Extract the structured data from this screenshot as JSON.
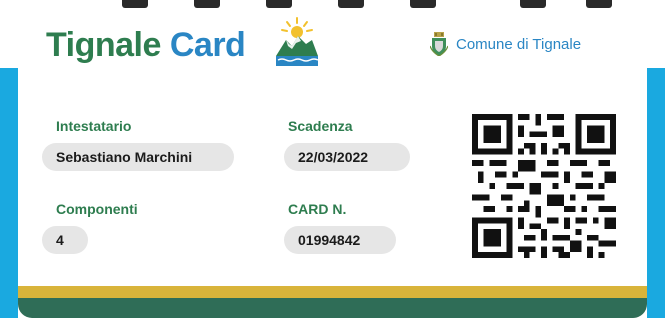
{
  "card": {
    "brand_part1": "Tignale",
    "brand_part2": "Card",
    "municipality": "Comune di Tignale"
  },
  "fields": {
    "holder_label": "Intestatario",
    "holder_value": "Sebastiano Marchini",
    "expiry_label": "Scadenza",
    "expiry_value": "22/03/2022",
    "members_label": "Componenti",
    "members_value": "4",
    "cardno_label": "CARD N.",
    "cardno_value": "01994842"
  },
  "icons": {
    "logo": "mountain-sun-logo",
    "crest": "municipal-crest-icon",
    "qr": "qr-code"
  },
  "colors": {
    "brand_green": "#2e7d4f",
    "brand_blue": "#2a86c4",
    "side_blue": "#1aa9e0",
    "stripe_yellow": "#d9b43a",
    "stripe_green": "#2f6d57"
  }
}
